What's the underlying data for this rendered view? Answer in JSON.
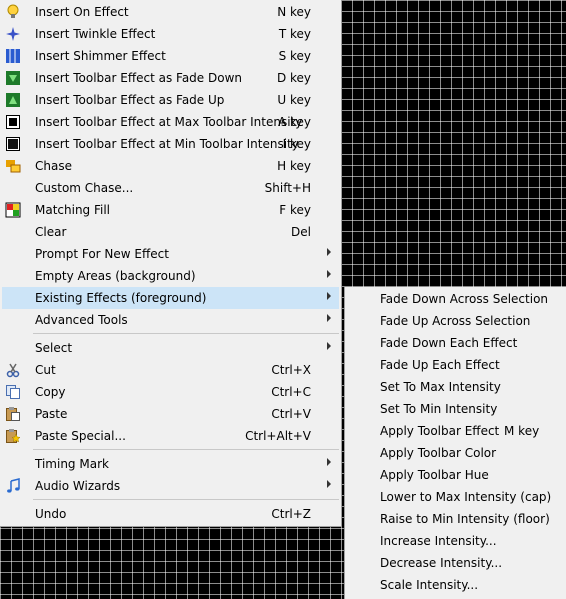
{
  "menu": {
    "items": [
      {
        "label": "Insert On Effect",
        "key": "N key",
        "icon": "bulb-icon"
      },
      {
        "label": "Insert Twinkle Effect",
        "key": "T key",
        "icon": "twinkle-icon"
      },
      {
        "label": "Insert Shimmer Effect",
        "key": "S key",
        "icon": "shimmer-icon"
      },
      {
        "label": "Insert Toolbar Effect as Fade Down",
        "key": "D key",
        "icon": "fade-down-icon"
      },
      {
        "label": "Insert Toolbar Effect as Fade Up",
        "key": "U key",
        "icon": "fade-up-icon"
      },
      {
        "label": "Insert Toolbar Effect at Max Toolbar Intensity",
        "key": "A key",
        "icon": "max-intensity-icon"
      },
      {
        "label": "Insert Toolbar Effect at Min Toolbar Intensity",
        "key": "I key",
        "icon": "min-intensity-icon"
      },
      {
        "label": "Chase",
        "key": "H key",
        "icon": "chase-icon"
      },
      {
        "label": "Custom Chase...",
        "key": "Shift+H"
      },
      {
        "label": "Matching Fill",
        "key": "F key",
        "icon": "matching-fill-icon"
      },
      {
        "label": "Clear",
        "key": "Del"
      },
      {
        "label": "Prompt For New Effect",
        "key": ""
      },
      {
        "label": "Empty Areas (background)",
        "key": ""
      },
      {
        "label": "Existing Effects (foreground)",
        "key": ""
      },
      {
        "label": "Advanced Tools",
        "key": ""
      },
      {
        "label": "Select",
        "key": ""
      },
      {
        "label": "Cut",
        "key": "Ctrl+X",
        "icon": "scissors-icon"
      },
      {
        "label": "Copy",
        "key": "Ctrl+C",
        "icon": "copy-icon"
      },
      {
        "label": "Paste",
        "key": "Ctrl+V",
        "icon": "paste-icon"
      },
      {
        "label": "Paste Special...",
        "key": "Ctrl+Alt+V",
        "icon": "paste-special-icon"
      },
      {
        "label": "Timing Mark",
        "key": ""
      },
      {
        "label": "Audio Wizards",
        "key": "",
        "icon": "music-note-icon"
      },
      {
        "label": "Undo",
        "key": "Ctrl+Z"
      }
    ]
  },
  "submenu": {
    "items": [
      {
        "label": "Fade Down Across Selection",
        "key": ""
      },
      {
        "label": "Fade Up Across Selection",
        "key": ""
      },
      {
        "label": "Fade Down Each Effect",
        "key": ""
      },
      {
        "label": "Fade Up Each Effect",
        "key": ""
      },
      {
        "label": "Set To Max Intensity",
        "key": ""
      },
      {
        "label": "Set To Min Intensity",
        "key": ""
      },
      {
        "label": "Apply Toolbar Effect",
        "key": "M key"
      },
      {
        "label": "Apply Toolbar Color",
        "key": ""
      },
      {
        "label": "Apply Toolbar Hue",
        "key": ""
      },
      {
        "label": "Lower to Max Intensity (cap)",
        "key": ""
      },
      {
        "label": "Raise to Min Intensity (floor)",
        "key": ""
      },
      {
        "label": "Increase Intensity...",
        "key": ""
      },
      {
        "label": "Decrease Intensity...",
        "key": ""
      },
      {
        "label": "Scale Intensity...",
        "key": ""
      }
    ]
  },
  "colors": {
    "menu_bg": "#f0f0f0",
    "highlight": "#cce4f7",
    "grid_bg": "#000000"
  }
}
